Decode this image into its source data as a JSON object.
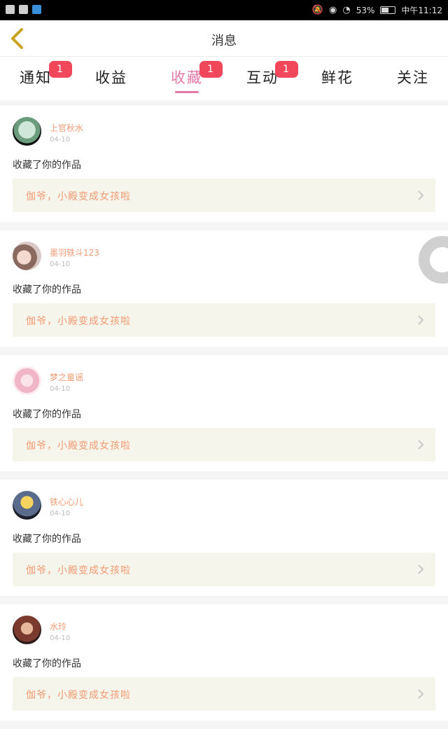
{
  "status_bar": {
    "battery": "53%",
    "time": "中午11:12",
    "battery_level": 0.53,
    "left_icons": [
      "android-icon",
      "android-icon",
      "app-icon"
    ],
    "right_icons": [
      "mute-icon",
      "eye-icon",
      "wifi-icon",
      "battery-icon"
    ]
  },
  "nav": {
    "title": "消息",
    "back_icon": "back-chevron-icon"
  },
  "tabs": [
    {
      "label": "通知",
      "badge": "1"
    },
    {
      "label": "收益",
      "badge": ""
    },
    {
      "label": "收藏",
      "badge": "1",
      "active": true
    },
    {
      "label": "互动",
      "badge": "1"
    },
    {
      "label": "鲜花",
      "badge": ""
    },
    {
      "label": "关注",
      "badge": ""
    }
  ],
  "items": [
    {
      "username": "上官秋水",
      "date": "04-10",
      "action": "收藏了你的作品",
      "work": "伽爷，小殿变成女孩啦"
    },
    {
      "username": "墨羽轶斗123",
      "date": "04-10",
      "action": "收藏了你的作品",
      "work": "伽爷，小殿变成女孩啦"
    },
    {
      "username": "梦之童谣",
      "date": "04-10",
      "action": "收藏了你的作品",
      "work": "伽爷，小殿变成女孩啦"
    },
    {
      "username": "铁心心儿",
      "date": "04-10",
      "action": "收藏了你的作品",
      "work": "伽爷，小殿变成女孩啦"
    },
    {
      "username": "水玲",
      "date": "04-10",
      "action": "收藏了你的作品",
      "work": "伽爷，小殿变成女孩啦"
    }
  ],
  "colors": {
    "accent": "#e27aa8",
    "badge": "#f0475b",
    "username": "#f19b74",
    "work_bg": "#f6f5ec"
  }
}
